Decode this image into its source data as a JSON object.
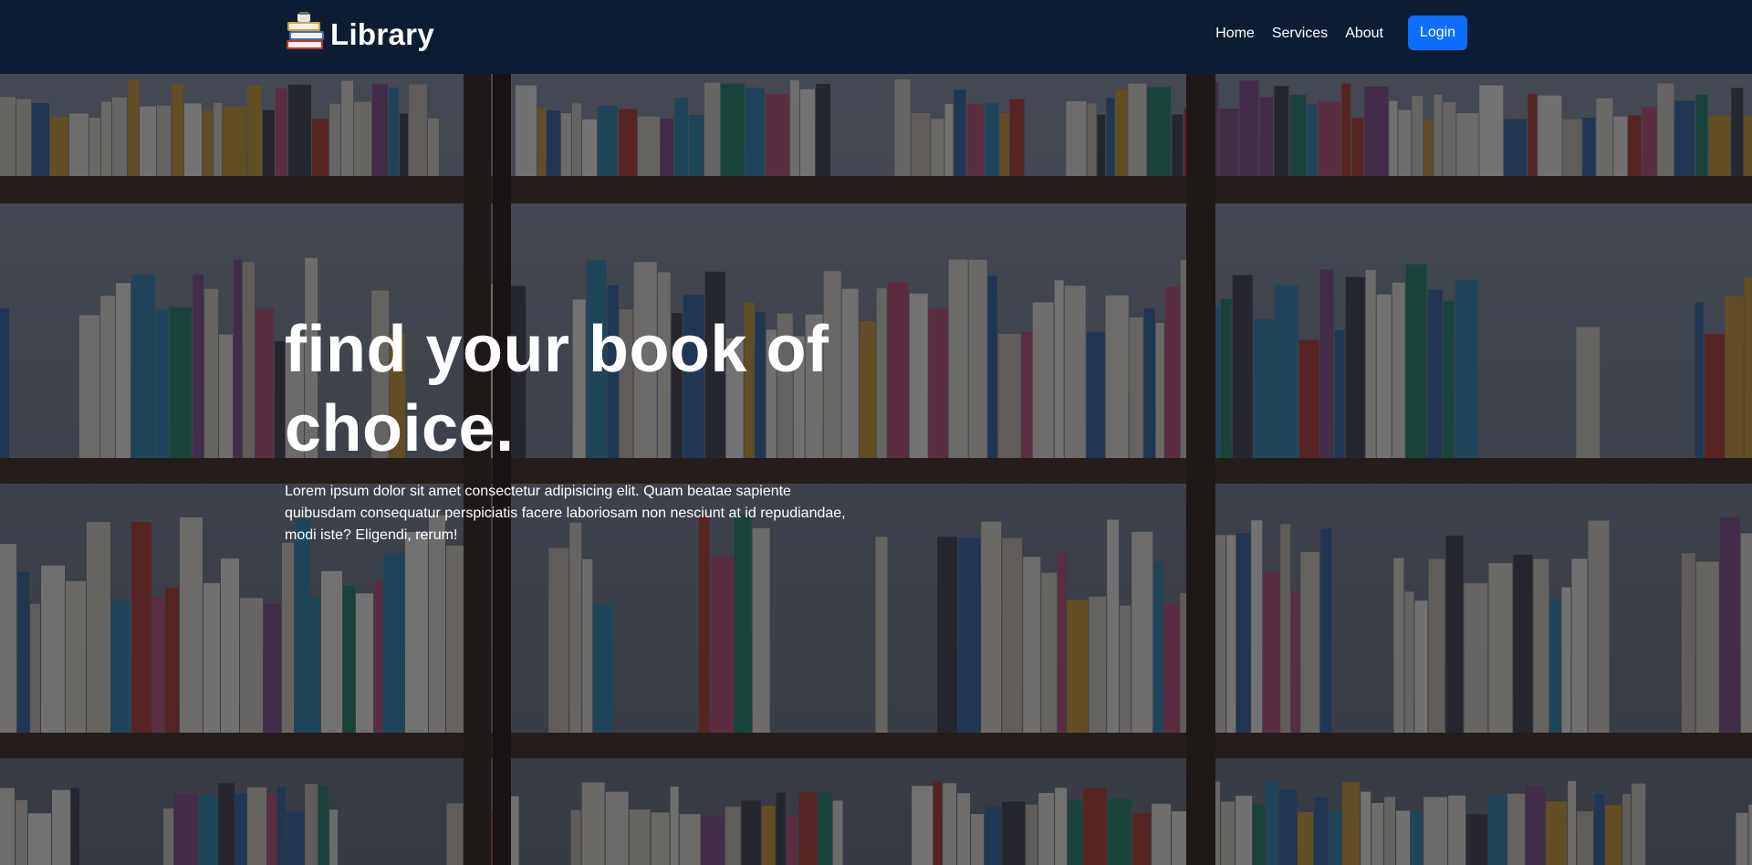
{
  "navbar": {
    "brand": "Library",
    "links": [
      "Home",
      "Services",
      "About"
    ],
    "login_label": "Login"
  },
  "hero": {
    "title": "find your book of choice.",
    "text": "Lorem ipsum dolor sit amet consectetur adipisicing elit. Quam beatae sapiente quibusdam consequatur perspiciatis facere laboriosam non nesciunt at id repudiandae, modi iste? Eligendi, rerum!"
  },
  "colors": {
    "navbar_bg": "#0c1d33",
    "accent": "#0d6efd",
    "text": "#ffffff"
  },
  "icons": {
    "brand_logo": "books-stack-icon"
  }
}
